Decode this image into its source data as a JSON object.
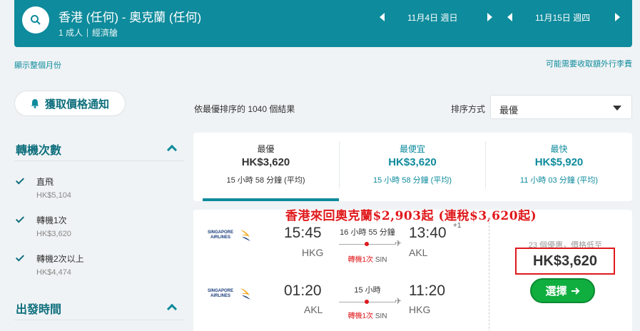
{
  "header": {
    "route": "香港 (任何) - 奧克蘭 (任何)",
    "passengers": "1 成人",
    "cabin": "經濟艙",
    "depart_date": "11月4日 週日",
    "return_date": "11月15日 週四"
  },
  "links": {
    "show_month": "顯示整個月份",
    "extra_fees": "可能需要收取額外行李費"
  },
  "sidebar": {
    "price_alert": "獲取價格通知",
    "stops_title": "轉機次數",
    "stops": [
      {
        "label": "直飛",
        "price": "HK$5,104"
      },
      {
        "label": "轉機1次",
        "price": "HK$3,620"
      },
      {
        "label": "轉機2次以上",
        "price": "HK$4,474"
      }
    ],
    "depart_time_title": "出發時間"
  },
  "results": {
    "count_text": "依最優排序的 1040 個結果",
    "sort_label": "排序方式",
    "sort_value": "最優"
  },
  "tabs": [
    {
      "label": "最優",
      "price": "HK$3,620",
      "duration": "15 小時 58 分鐘 (平均)"
    },
    {
      "label": "最便宜",
      "price": "HK$3,620",
      "duration": "15 小時 58 分鐘 (平均)"
    },
    {
      "label": "最快",
      "price": "HK$5,920",
      "duration": "11 小時 03 分鐘 (平均)"
    }
  ],
  "promo": "香港來回奧克蘭$2,903起 (連稅$3,620起)",
  "result": {
    "airline": "SINGAPORE AIRLINES",
    "outbound": {
      "dep_time": "15:45",
      "arr_time": "13:40",
      "day_offset": "+1",
      "dep_airport": "HKG",
      "arr_airport": "AKL",
      "duration": "16 小時 55 分鐘",
      "stops": "轉機1次",
      "via": "SIN"
    },
    "inbound": {
      "dep_time": "01:20",
      "arr_time": "11:20",
      "dep_airport": "AKL",
      "arr_airport": "HKG",
      "duration": "15 小時",
      "stops": "轉機1次",
      "via": "SIN"
    },
    "deals": "23 個優惠，價格低至",
    "price": "HK$3,620",
    "select_label": "選擇"
  },
  "colors": {
    "teal": "#0e8b9c",
    "red": "#e0191c",
    "green": "#0fae3f"
  }
}
